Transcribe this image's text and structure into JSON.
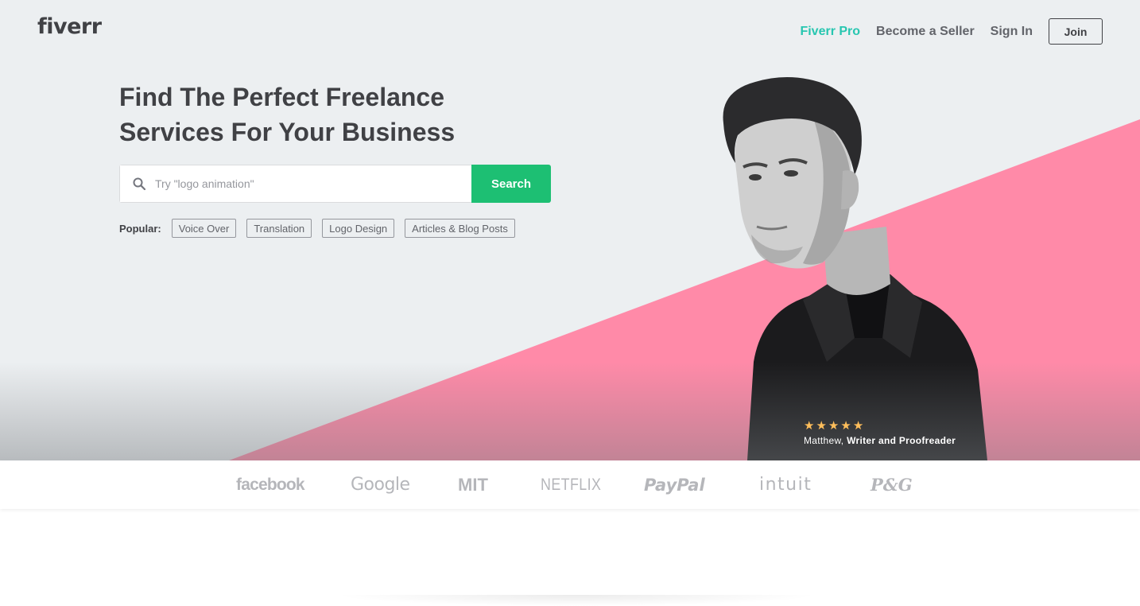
{
  "brand": {
    "logo_text": "fiverr"
  },
  "nav": {
    "pro_label": "Fiverr Pro",
    "seller_label": "Become a Seller",
    "signin_label": "Sign In",
    "join_label": "Join"
  },
  "hero": {
    "headline_line1": "Find The Perfect Freelance",
    "headline_line2": "Services For Your Business",
    "search": {
      "placeholder": "Try \"logo animation\"",
      "value": "",
      "button_label": "Search"
    },
    "popular": {
      "label": "Popular:",
      "tags": [
        "Voice Over",
        "Translation",
        "Logo Design",
        "Articles & Blog Posts"
      ]
    },
    "testimonial": {
      "rating": 5,
      "name": "Matthew,",
      "role": "Writer and Proofreader"
    }
  },
  "trusted_by": {
    "logos": [
      "facebook",
      "Google",
      "MIT",
      "NETFLIX",
      "PayPal",
      "intuit",
      "P&G"
    ]
  },
  "colors": {
    "accent_green": "#1dbf73",
    "pro_teal": "#27c6b0",
    "pink": "#ff8aa8",
    "hero_bg": "#eceff1",
    "star": "#ffbe5b"
  }
}
